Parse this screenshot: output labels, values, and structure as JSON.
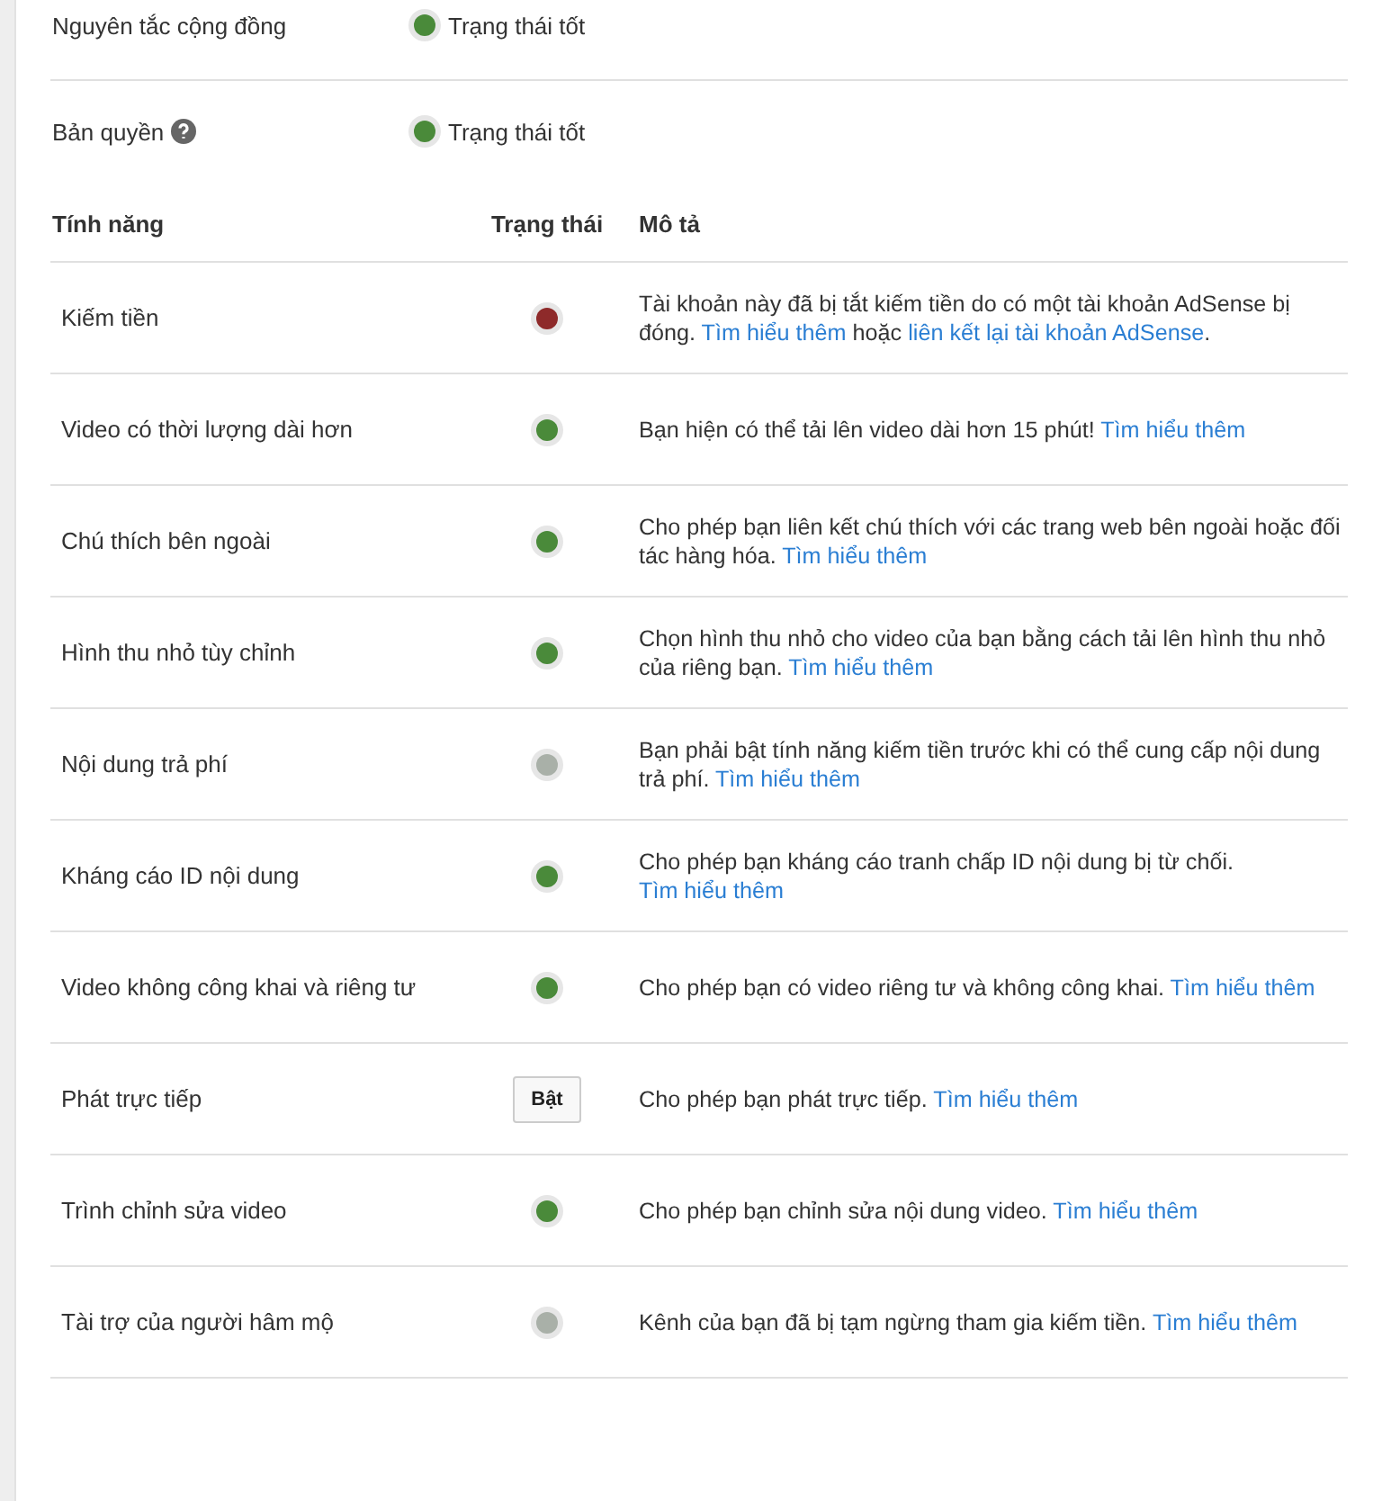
{
  "summary": [
    {
      "label": "Nguyên tắc cộng đồng",
      "help": false,
      "status": "Trạng thái tốt",
      "color": "#4a8a3a"
    },
    {
      "label": "Bản quyền",
      "help": true,
      "status": "Trạng thái tốt",
      "color": "#4a8a3a"
    }
  ],
  "table": {
    "columns": [
      "Tính năng",
      "Trạng thái",
      "Mô tả"
    ],
    "rows": [
      {
        "feature": "Kiếm tiền",
        "kind": "dot",
        "color": "#8e2a2a",
        "description": [
          {
            "kind": "text",
            "text": "Tài khoản này đã bị tắt kiếm tiền do có một tài khoản AdSense bị đóng. "
          },
          {
            "kind": "link",
            "text": "Tìm hiểu thêm"
          },
          {
            "kind": "text",
            "text": " hoặc "
          },
          {
            "kind": "link",
            "text": "liên kết lại tài khoản AdSense"
          },
          {
            "kind": "text",
            "text": "."
          }
        ]
      },
      {
        "feature": "Video có thời lượng dài hơn",
        "kind": "dot",
        "color": "#4a8a3a",
        "description": [
          {
            "kind": "text",
            "text": "Bạn hiện có thể tải lên video dài hơn 15 phút! "
          },
          {
            "kind": "link",
            "text": "Tìm hiểu thêm"
          }
        ]
      },
      {
        "feature": "Chú thích bên ngoài",
        "kind": "dot",
        "color": "#4a8a3a",
        "description": [
          {
            "kind": "text",
            "text": "Cho phép bạn liên kết chú thích với các trang web bên ngoài hoặc đối tác hàng hóa. "
          },
          {
            "kind": "link",
            "text": "Tìm hiểu thêm"
          }
        ]
      },
      {
        "feature": "Hình thu nhỏ tùy chỉnh",
        "kind": "dot",
        "color": "#4a8a3a",
        "description": [
          {
            "kind": "text",
            "text": "Chọn hình thu nhỏ cho video của bạn bằng cách tải lên hình thu nhỏ của riêng bạn. "
          },
          {
            "kind": "link",
            "text": "Tìm hiểu thêm"
          }
        ]
      },
      {
        "feature": "Nội dung trả phí",
        "kind": "dot",
        "color": "#a9b0a8",
        "description": [
          {
            "kind": "text",
            "text": "Bạn phải bật tính năng kiếm tiền trước khi có thể cung cấp nội dung trả phí. "
          },
          {
            "kind": "link",
            "text": "Tìm hiểu thêm"
          }
        ]
      },
      {
        "feature": "Kháng cáo ID nội dung",
        "kind": "dot",
        "color": "#4a8a3a",
        "description": [
          {
            "kind": "text",
            "text": "Cho phép bạn kháng cáo tranh chấp ID nội dung bị từ chối. "
          },
          {
            "kind": "link",
            "text": "Tìm hiểu thêm"
          }
        ]
      },
      {
        "feature": "Video không công khai và riêng tư",
        "kind": "dot",
        "color": "#4a8a3a",
        "description": [
          {
            "kind": "text",
            "text": "Cho phép bạn có video riêng tư và không công khai. "
          },
          {
            "kind": "link",
            "text": "Tìm hiểu thêm"
          }
        ]
      },
      {
        "feature": "Phát trực tiếp",
        "kind": "button",
        "button": "Bật",
        "description": [
          {
            "kind": "text",
            "text": "Cho phép bạn phát trực tiếp. "
          },
          {
            "kind": "link",
            "text": "Tìm hiểu thêm"
          }
        ]
      },
      {
        "feature": "Trình chỉnh sửa video",
        "kind": "dot",
        "color": "#4a8a3a",
        "description": [
          {
            "kind": "text",
            "text": "Cho phép bạn chỉnh sửa nội dung video. "
          },
          {
            "kind": "link",
            "text": "Tìm hiểu thêm"
          }
        ]
      },
      {
        "feature": "Tài trợ của người hâm mộ",
        "kind": "dot",
        "color": "#a9b0a8",
        "description": [
          {
            "kind": "text",
            "text": "Kênh của bạn đã bị tạm ngừng tham gia kiếm tiền. "
          },
          {
            "kind": "link",
            "text": "Tìm hiểu thêm"
          }
        ]
      }
    ]
  }
}
